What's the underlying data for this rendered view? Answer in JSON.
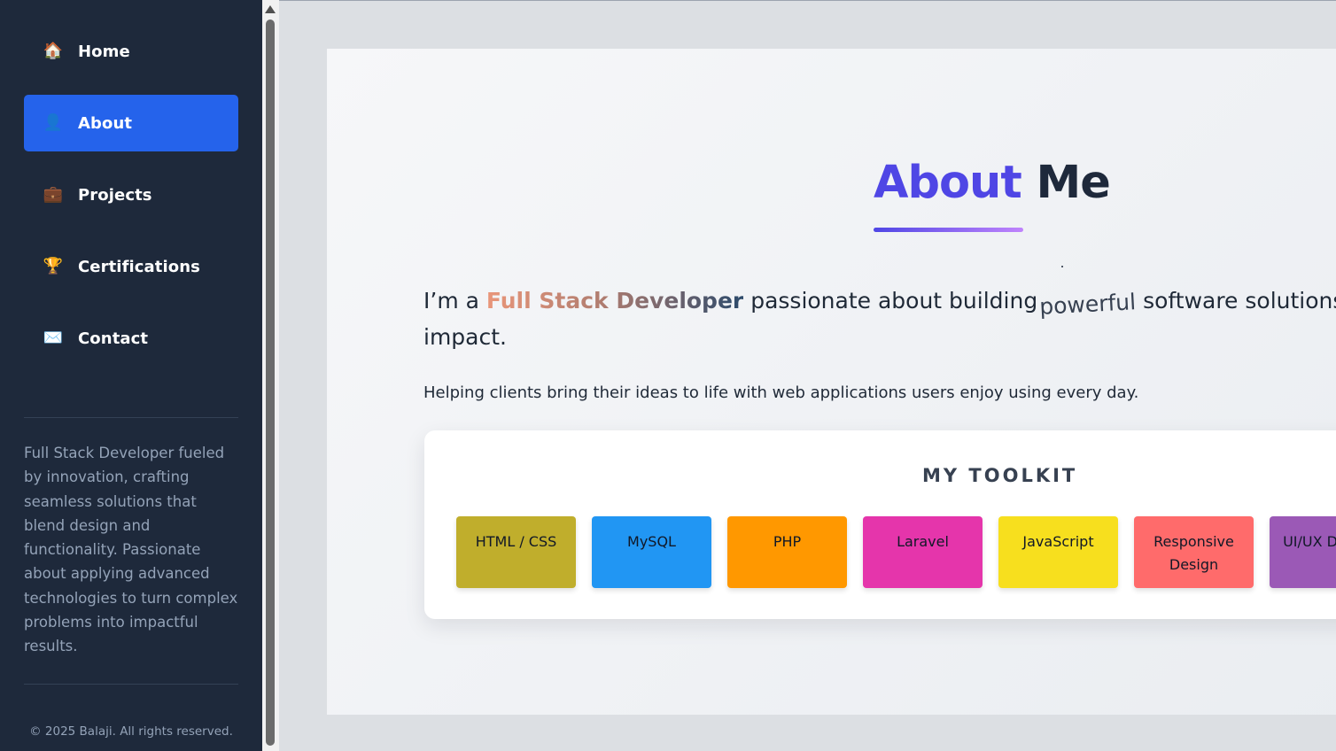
{
  "sidebar": {
    "items": [
      {
        "label": "Home",
        "icon": "house-icon",
        "glyph": "🏠",
        "active": false
      },
      {
        "label": "About",
        "icon": "person-icon",
        "glyph": "👤",
        "active": true
      },
      {
        "label": "Projects",
        "icon": "briefcase-icon",
        "glyph": "💼",
        "active": false
      },
      {
        "label": "Certifications",
        "icon": "trophy-icon",
        "glyph": "🏆",
        "active": false
      },
      {
        "label": "Contact",
        "icon": "envelope-icon",
        "glyph": "✉️",
        "active": false
      }
    ],
    "bio": "Full Stack Developer fueled by innovation, crafting seamless solutions that blend design and functionality. Passionate about applying advanced technologies to turn complex problems into impactful results.",
    "footer": "© 2025 Balaji. All rights reserved."
  },
  "about": {
    "title_accent": "About",
    "title_rest": "Me",
    "intro_prefix": "I’m a",
    "intro_role": "Full Stack Developer",
    "intro_middle": "passionate about building",
    "intro_typed": "powerful",
    "intro_suffix": "software solutions that create impact.",
    "helper": "Helping clients bring their ideas to life with web applications users enjoy using every day."
  },
  "toolkit": {
    "title": "MY TOOLKIT",
    "tools": [
      {
        "label": "HTML / CSS",
        "color": "#c0ae2c"
      },
      {
        "label": "MySQL",
        "color": "#2196f3"
      },
      {
        "label": "PHP",
        "color": "#ff9800"
      },
      {
        "label": "Laravel",
        "color": "#e535ab"
      },
      {
        "label": "JavaScript",
        "color": "#f7df1e"
      },
      {
        "label": "Responsive Design",
        "color": "#ff6b6b"
      },
      {
        "label": "UI/UX Design",
        "color": "#9b59b6"
      }
    ]
  },
  "colors": {
    "sidebar_bg": "#1e293b",
    "active_nav": "#2563eb",
    "title_accent": "#4f46e5"
  }
}
